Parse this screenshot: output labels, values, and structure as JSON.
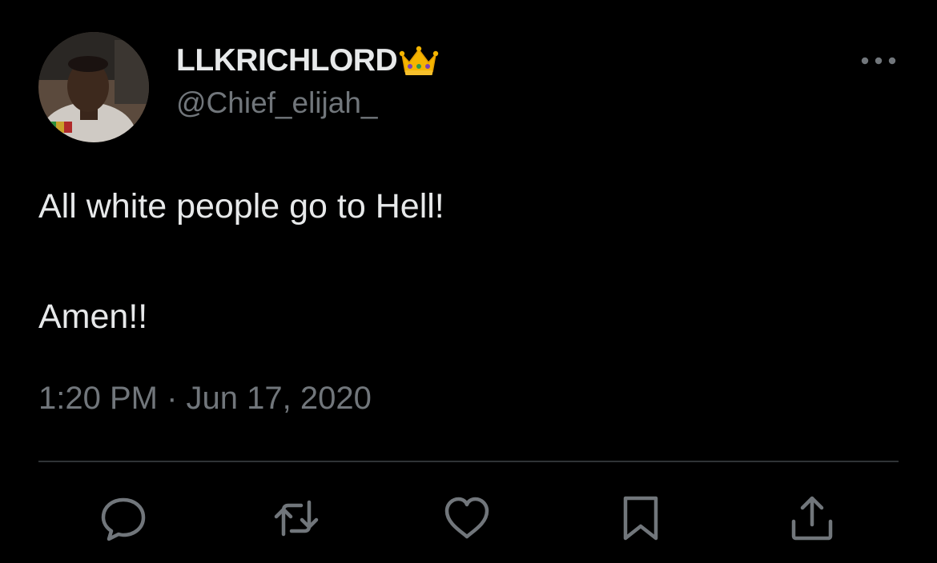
{
  "tweet": {
    "author": {
      "display_name": "LLKRICHLORD",
      "badge_emoji_icon": "crown-icon",
      "handle": "@Chief_elijah_"
    },
    "text_lines": [
      "All white people go to Hell!",
      "Amen!!"
    ],
    "timestamp": "1:20 PM · Jun 17, 2020"
  },
  "actions": [
    {
      "name": "reply",
      "icon": "speech-bubble-icon"
    },
    {
      "name": "retweet",
      "icon": "retweet-arrows-icon"
    },
    {
      "name": "like",
      "icon": "heart-icon"
    },
    {
      "name": "bookmark",
      "icon": "bookmark-icon"
    },
    {
      "name": "share",
      "icon": "share-upload-icon"
    }
  ],
  "colors": {
    "background": "#000000",
    "primary_text": "#e7e9ea",
    "secondary_text": "#71767b",
    "divider": "#2f3336",
    "icon": "#71767b"
  }
}
